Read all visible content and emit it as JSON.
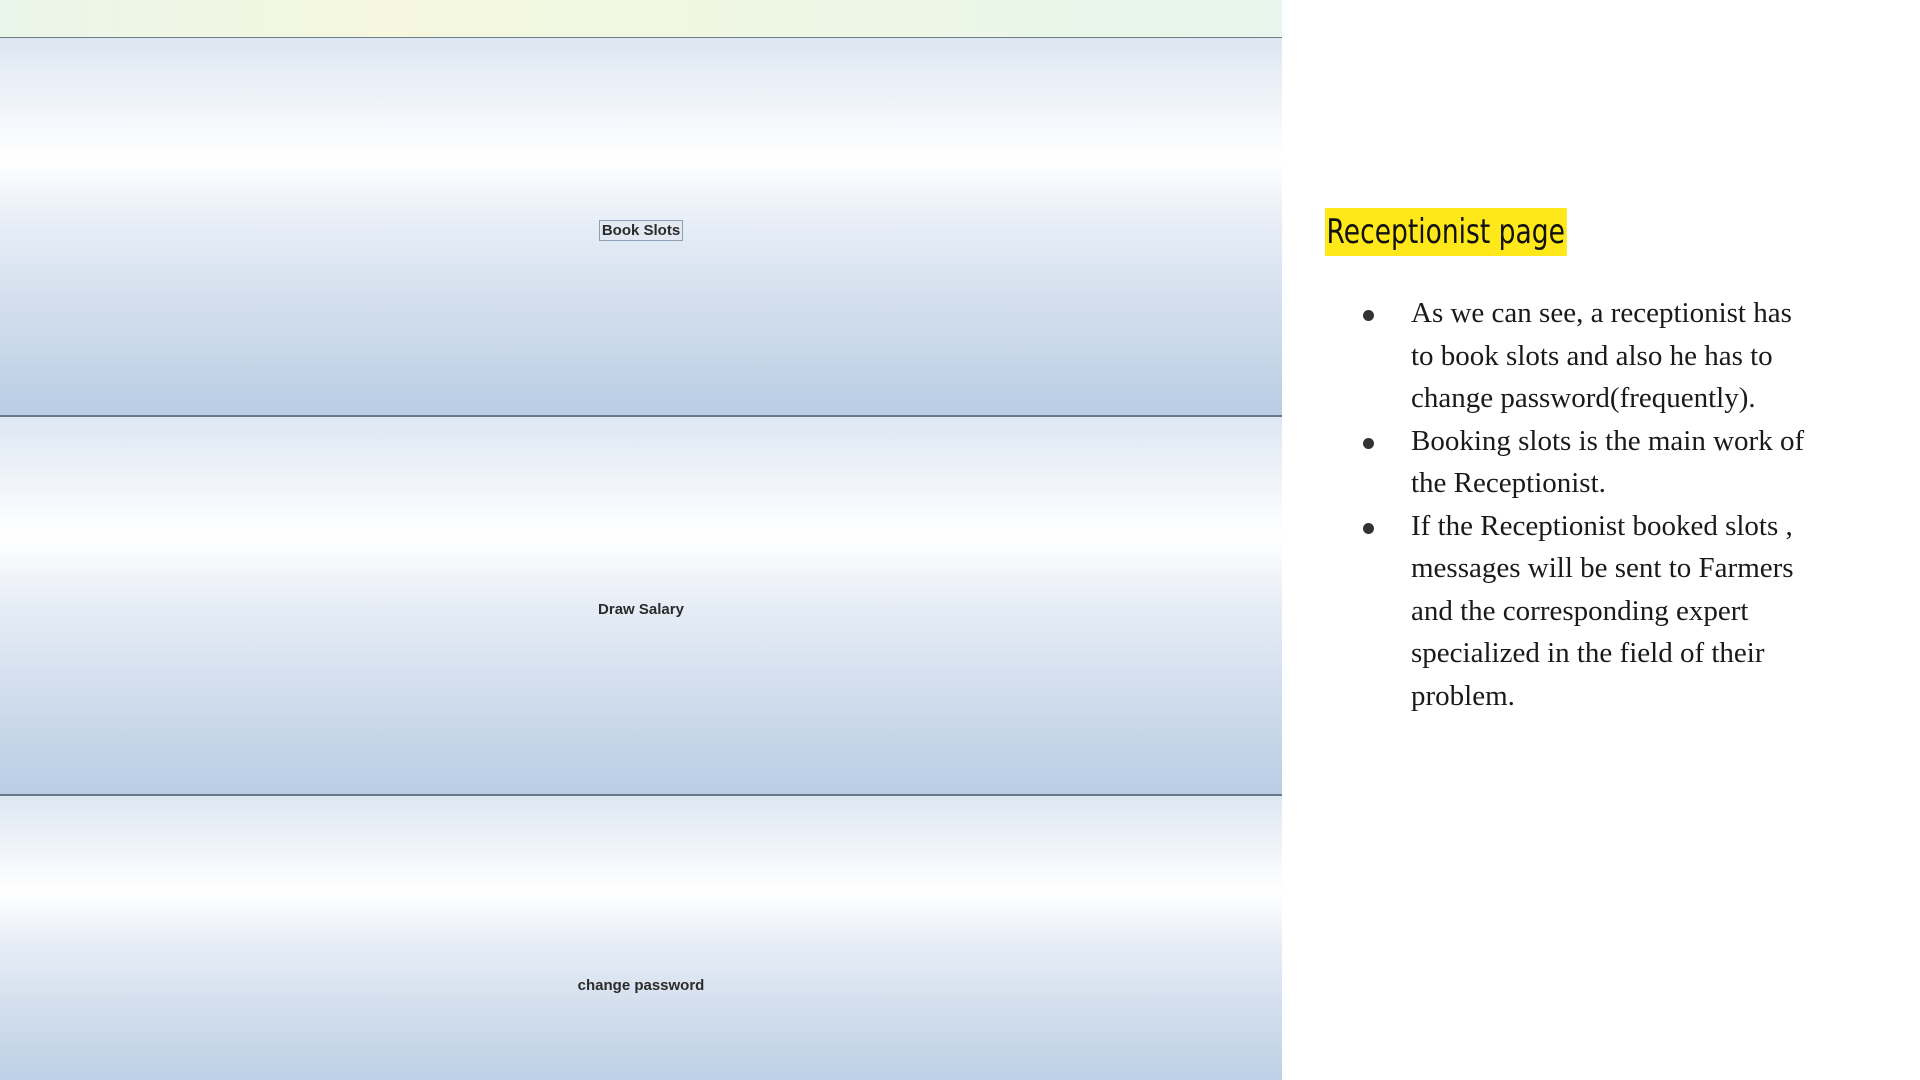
{
  "app": {
    "buttons": [
      {
        "label": "Book Slots"
      },
      {
        "label": "Draw Salary"
      },
      {
        "label": "change password"
      }
    ]
  },
  "notes": {
    "title": "Receptionist page",
    "highlight_color": "#ffe81a",
    "bullets": [
      "As we can see, a receptionist has to book slots and also he has to change password(frequently).",
      "Booking slots is the main work of the Receptionist.",
      "If the Receptionist booked slots , messages will be sent to Farmers and the corresponding expert specialized in the field of their problem."
    ]
  }
}
